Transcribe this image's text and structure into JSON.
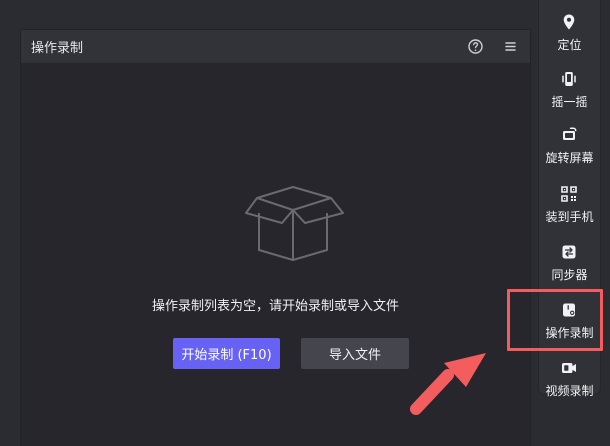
{
  "panel": {
    "title": "操作录制",
    "empty_message": "操作录制列表为空，请开始录制或导入文件",
    "buttons": {
      "start": "开始录制 (F10)",
      "import": "导入文件"
    },
    "header_icons": [
      "help-icon",
      "menu-icon"
    ]
  },
  "toolbar": {
    "items": [
      {
        "label": "定位",
        "icon": "location-icon"
      },
      {
        "label": "摇一摇",
        "icon": "shake-icon"
      },
      {
        "label": "旋转屏幕",
        "icon": "rotate-screen-icon"
      },
      {
        "label": "装到手机",
        "icon": "qr-code-icon"
      },
      {
        "label": "同步器",
        "icon": "sync-icon"
      },
      {
        "label": "操作录制",
        "icon": "operation-record-icon"
      },
      {
        "label": "视频录制",
        "icon": "video-record-icon"
      }
    ],
    "highlighted_item": "操作录制"
  },
  "colors": {
    "background": "#2b2c31",
    "panel": "#27262c",
    "header": "#323339",
    "primary_button": "#6762f4",
    "secondary_button": "#45464d",
    "highlight": "#f45d5d"
  }
}
